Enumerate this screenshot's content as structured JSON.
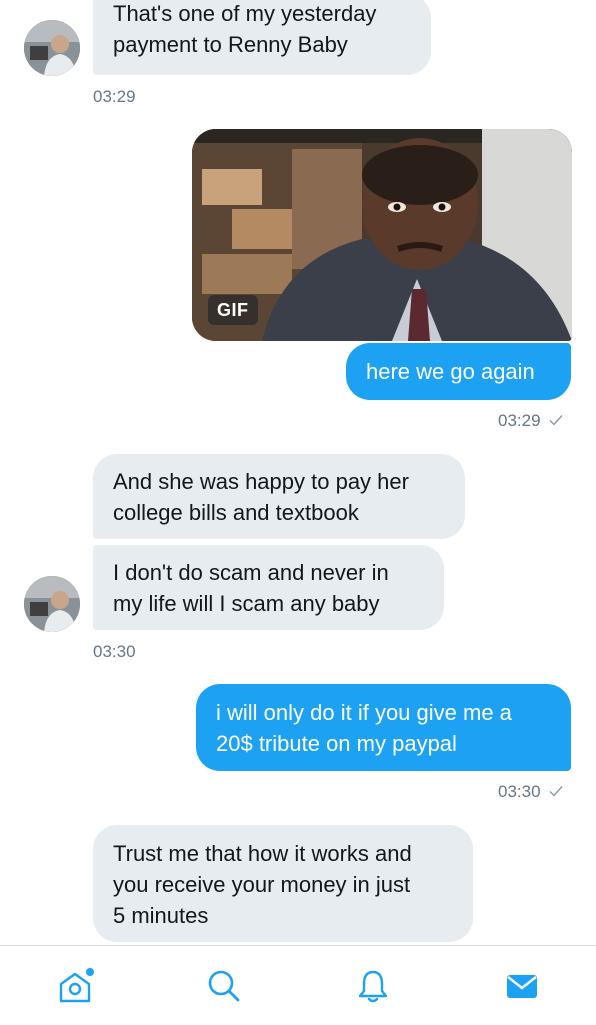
{
  "messages": [
    {
      "id": "m1",
      "direction": "incoming",
      "lines": [
        "That's one of my yesterday",
        "payment to Renny Baby"
      ]
    },
    {
      "id": "m2",
      "direction": "outgoing",
      "type": "gif",
      "badge": "GIF"
    },
    {
      "id": "m3",
      "direction": "outgoing",
      "lines": [
        "here we go again"
      ]
    },
    {
      "id": "m4",
      "direction": "incoming",
      "lines": [
        "And she was happy to pay her",
        "college bills and textbook"
      ]
    },
    {
      "id": "m5",
      "direction": "incoming",
      "lines": [
        "I don't do scam and never in",
        "my life will I scam any baby"
      ]
    },
    {
      "id": "m6",
      "direction": "outgoing",
      "lines": [
        "i will only do it if you give me a",
        "20$ tribute on my paypal"
      ]
    },
    {
      "id": "m7",
      "direction": "incoming",
      "lines": [
        "Trust me that how it works and",
        "you receive your money in just",
        "5 minutes"
      ]
    }
  ],
  "timestamps": {
    "t1": "03:29",
    "t2": "03:29",
    "t3": "03:30",
    "t4": "03:30"
  },
  "read_receipt_icon": "checkmark-icon",
  "tabs": [
    {
      "name": "home",
      "icon": "home-icon",
      "active": false,
      "has_notification_dot": true
    },
    {
      "name": "search",
      "icon": "search-icon",
      "active": false
    },
    {
      "name": "notifications",
      "icon": "bell-icon",
      "active": false
    },
    {
      "name": "messages",
      "icon": "mail-icon",
      "active": true
    }
  ],
  "colors": {
    "outgoing_bubble": "#1da1f2",
    "incoming_bubble": "#e6ecf0",
    "timestamp": "#657786",
    "inactive_icon": "#1da1f2",
    "notification_dot": "#1da1f2"
  }
}
